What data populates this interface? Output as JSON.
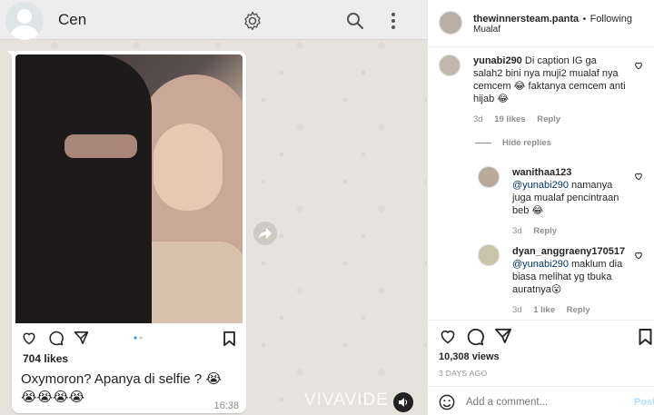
{
  "chat": {
    "contact_name": "Cen",
    "message": {
      "likes": "704 likes",
      "caption": "Oxymoron? Apanya di selfie ? 😭",
      "emoji_line": "😭😭😭😭",
      "time": "16:38"
    },
    "watermark": "VIVAVIDE"
  },
  "post": {
    "username": "thewinnersteam.panta",
    "separator": "•",
    "follow_status": "Following",
    "subtitle": "Mualaf",
    "comments": [
      {
        "username": "yunabi290",
        "text": "Di caption IG ga salah2 bini nya muji2 mualaf nya cemcem 😂 faktanya cemcem anti hijab 😂",
        "age": "3d",
        "likes": "19 likes",
        "reply_label": "Reply",
        "hide_replies": "Hide replies"
      }
    ],
    "replies": [
      {
        "username": "wanithaa123",
        "mention": "@yunabi290",
        "text": "namanya juga mualaf pencintraan beb 😂",
        "age": "3d",
        "reply_label": "Reply"
      },
      {
        "username": "dyan_anggraeny170517",
        "mention": "@yunabi290",
        "text": "maklum dia biasa melihat yg tbuka auratnya😮",
        "age": "3d",
        "likes": "1 like",
        "reply_label": "Reply"
      }
    ],
    "views": "10,308 views",
    "posted": "3 DAYS AGO",
    "add_comment_placeholder": "Add a comment...",
    "post_button": "Post"
  },
  "colors": {
    "chat_bg": "#e6e2dc",
    "header_bg": "#ededed",
    "link": "#00376b",
    "post_button": "#b2dffc",
    "muted": "#8e8e8e"
  },
  "icons": [
    "settings-gear-icon",
    "search-icon",
    "more-vertical-icon",
    "forward-icon",
    "heart-icon",
    "comment-icon",
    "share-icon",
    "bookmark-icon",
    "emoji-icon",
    "volume-icon"
  ]
}
